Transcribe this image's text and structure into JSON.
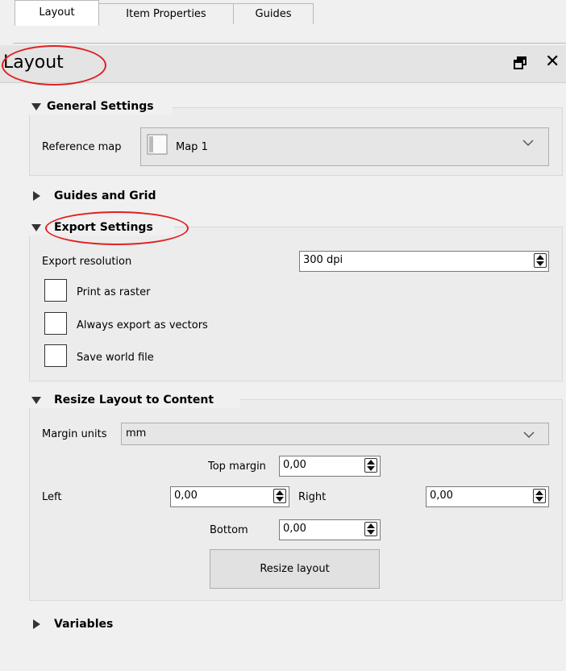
{
  "tabs": [
    {
      "label": "Layout"
    },
    {
      "label": "Item Properties"
    },
    {
      "label": "Guides"
    }
  ],
  "dock": {
    "title": "Layout",
    "float_icon": "float-window-icon",
    "close_icon": "close-icon"
  },
  "general_settings": {
    "title": "General Settings",
    "reference_map_label": "Reference map",
    "reference_map_value": "Map 1"
  },
  "guides_grid": {
    "title": "Guides and Grid"
  },
  "export_settings": {
    "title": "Export Settings",
    "resolution_label": "Export resolution",
    "resolution_value": "300 dpi",
    "checkboxes": [
      {
        "label": "Print as raster",
        "checked": false
      },
      {
        "label": "Always export as vectors",
        "checked": false
      },
      {
        "label": "Save world file",
        "checked": false
      }
    ]
  },
  "resize": {
    "title": "Resize Layout to Content",
    "margin_units_label": "Margin units",
    "margin_units_value": "mm",
    "top_label": "Top margin",
    "top_value": "0,00",
    "left_label": "Left",
    "left_value": "0,00",
    "right_label": "Right",
    "right_value": "0,00",
    "bottom_label": "Bottom",
    "bottom_value": "0,00",
    "button_label": "Resize layout"
  },
  "variables": {
    "title": "Variables"
  },
  "colors": {
    "annotation": "#e02020",
    "header_bg": "#e4e4e4",
    "panel_bg": "#f0f0f0"
  }
}
